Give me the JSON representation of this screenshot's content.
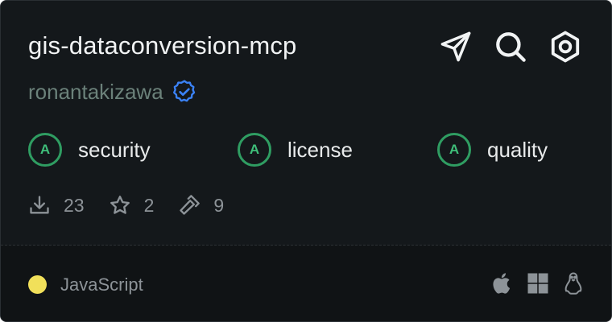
{
  "header": {
    "title": "gis-dataconversion-mcp",
    "owner": "ronantakizawa"
  },
  "icons": {
    "verified": "verified-badge-icon",
    "send": "send-icon",
    "search": "search-icon",
    "settings": "settings-hex-icon",
    "downloads": "download-icon",
    "stars": "star-icon",
    "tools": "hammer-icon",
    "apple": "apple-icon",
    "windows": "windows-icon",
    "linux": "linux-icon"
  },
  "grades": [
    {
      "grade": "A",
      "label": "security"
    },
    {
      "grade": "A",
      "label": "license"
    },
    {
      "grade": "A",
      "label": "quality"
    }
  ],
  "stats": {
    "downloads": "23",
    "stars": "2",
    "tools": "9"
  },
  "footer": {
    "language": "JavaScript"
  },
  "colors": {
    "background": "#14181b",
    "accent_green": "#2f9d62",
    "verified_blue": "#3b82f6",
    "language_dot": "#f1e05a"
  }
}
